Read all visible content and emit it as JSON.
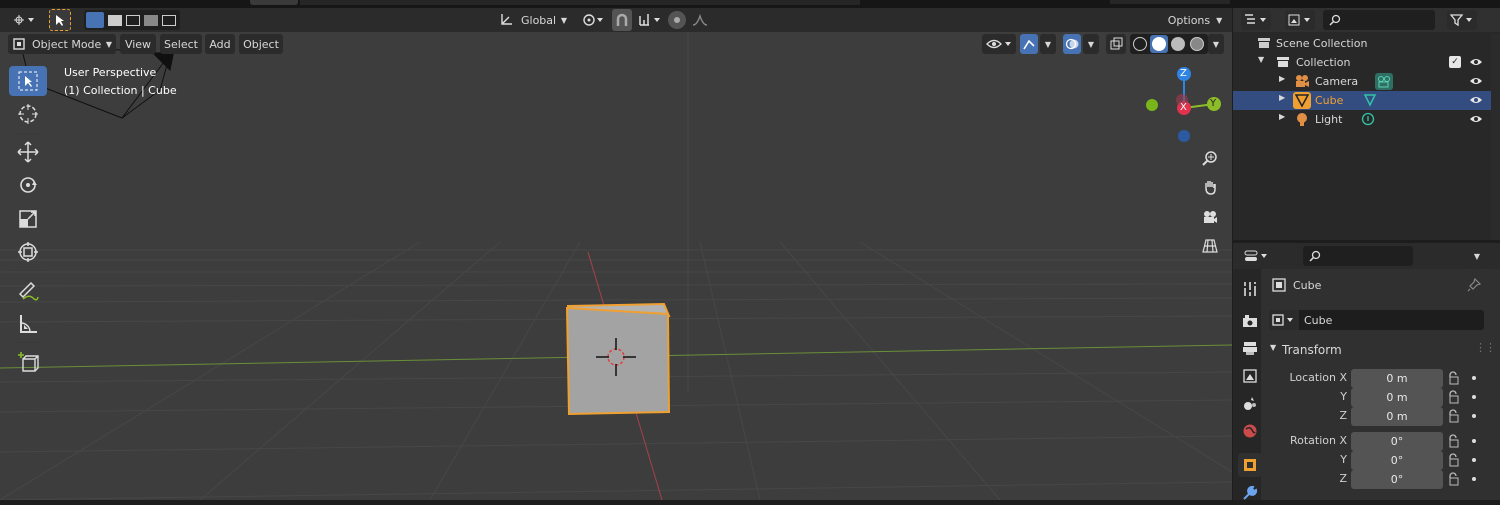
{
  "header": {
    "transform_orientation": "Global",
    "options_label": "Options"
  },
  "viewport_header": {
    "mode": "Object Mode",
    "menus": [
      "View",
      "Select",
      "Add",
      "Object"
    ]
  },
  "viewport": {
    "perspective_label": "User Perspective",
    "context_label": "(1) Collection | Cube",
    "gizmo_axes": {
      "z": "Z",
      "y": "Y",
      "x": "X"
    }
  },
  "tools": [
    "select-box",
    "cursor",
    "move",
    "rotate",
    "scale",
    "transform",
    "annotate",
    "measure",
    "add-cube"
  ],
  "outliner": {
    "scene_collection": "Scene Collection",
    "collection": "Collection",
    "items": [
      {
        "label": "Camera",
        "selected": false
      },
      {
        "label": "Cube",
        "selected": true
      },
      {
        "label": "Light",
        "selected": false
      }
    ]
  },
  "properties": {
    "object_name": "Cube",
    "data_name": "Cube",
    "panel_title": "Transform",
    "location": {
      "label": "Location X",
      "x": "0 m",
      "y": "0 m",
      "z": "0 m",
      "y_label": "Y",
      "z_label": "Z"
    },
    "rotation": {
      "label": "Rotation X",
      "x": "0°",
      "y": "0°",
      "z": "0°",
      "y_label": "Y",
      "z_label": "Z"
    }
  },
  "colors": {
    "accent": "#4772b3",
    "selection": "#f0a030",
    "axis_x": "#e2334e",
    "axis_y": "#8cbc28",
    "axis_z": "#2f84e3"
  }
}
